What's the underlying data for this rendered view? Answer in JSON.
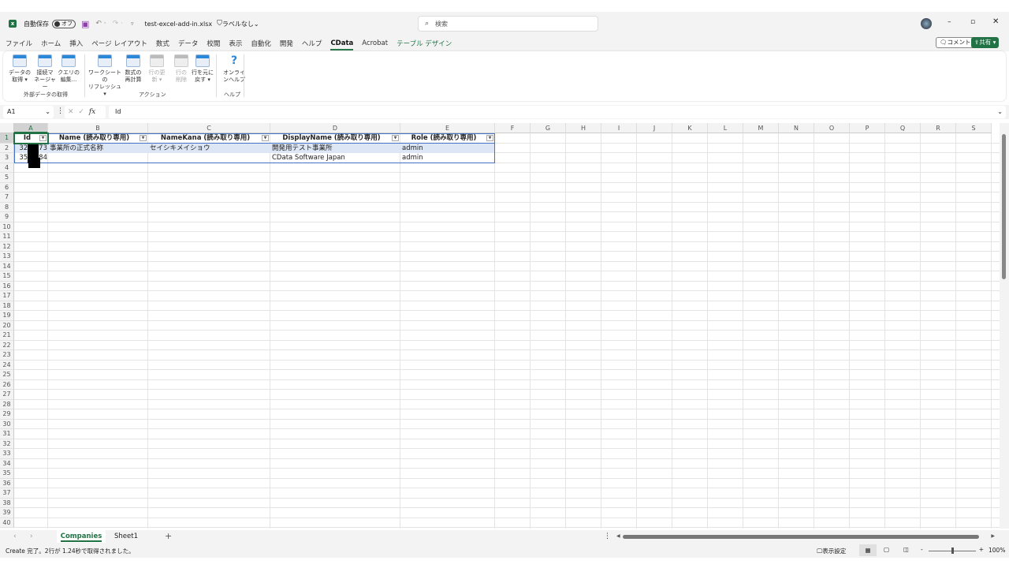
{
  "title": {
    "autosave": "自動保存",
    "toggle": "オフ",
    "filename": "test-excel-add-in.xlsx",
    "label": "ラベルなし",
    "search": "検索"
  },
  "tabs": [
    "ファイル",
    "ホーム",
    "挿入",
    "ページ レイアウト",
    "数式",
    "データ",
    "校閲",
    "表示",
    "自動化",
    "開発",
    "ヘルプ",
    "CData",
    "Acrobat",
    "テーブル デザイン"
  ],
  "right_buttons": {
    "comment": "コメント",
    "share": "共有"
  },
  "ribbon": {
    "buttons": [
      {
        "l1": "データの",
        "l2": "取得 ▾"
      },
      {
        "l1": "接続マ",
        "l2": "ネージャー"
      },
      {
        "l1": "クエリの",
        "l2": "編集..."
      },
      {
        "l1": "ワークシートの",
        "l2": "リフレッシュ ▾"
      },
      {
        "l1": "数式の",
        "l2": "再計算"
      },
      {
        "l1": "行の更",
        "l2": "新 ▾"
      },
      {
        "l1": "行の",
        "l2": "削除"
      },
      {
        "l1": "行を元に",
        "l2": "戻す ▾"
      },
      {
        "l1": "オンライ",
        "l2": "ンヘルプ"
      }
    ],
    "groups": [
      "外部データの取得",
      "アクション",
      "ヘルプ"
    ]
  },
  "formula": {
    "namebox": "A1",
    "fx": "fx",
    "value": "Id"
  },
  "columns": [
    "A",
    "B",
    "C",
    "D",
    "E",
    "F",
    "G",
    "H",
    "I",
    "J",
    "K",
    "L",
    "M",
    "N",
    "O",
    "P",
    "Q",
    "R",
    "S"
  ],
  "table": {
    "headers": [
      "Id",
      "Name (読み取り専用)",
      "NameKana (読み取り専用)",
      "DisplayName (読み取り専用)",
      "Role (読み取り専用)"
    ],
    "rows": [
      {
        "id_pre": "32",
        "id_suf": "73",
        "name": "事業所の正式名称",
        "kana": "セイシキメイショウ",
        "display": "開発用テスト事業所",
        "role": "admin"
      },
      {
        "id_pre": "35",
        "id_suf": "84",
        "name": "",
        "kana": "",
        "display": "CData Software Japan",
        "role": "admin"
      }
    ]
  },
  "sheets": [
    "Companies",
    "Sheet1"
  ],
  "status": {
    "message": "Create 完了。2行が 1.24秒で取得されました。",
    "display_settings": "表示設定",
    "zoom": "100%",
    "zoom_value": 100
  }
}
